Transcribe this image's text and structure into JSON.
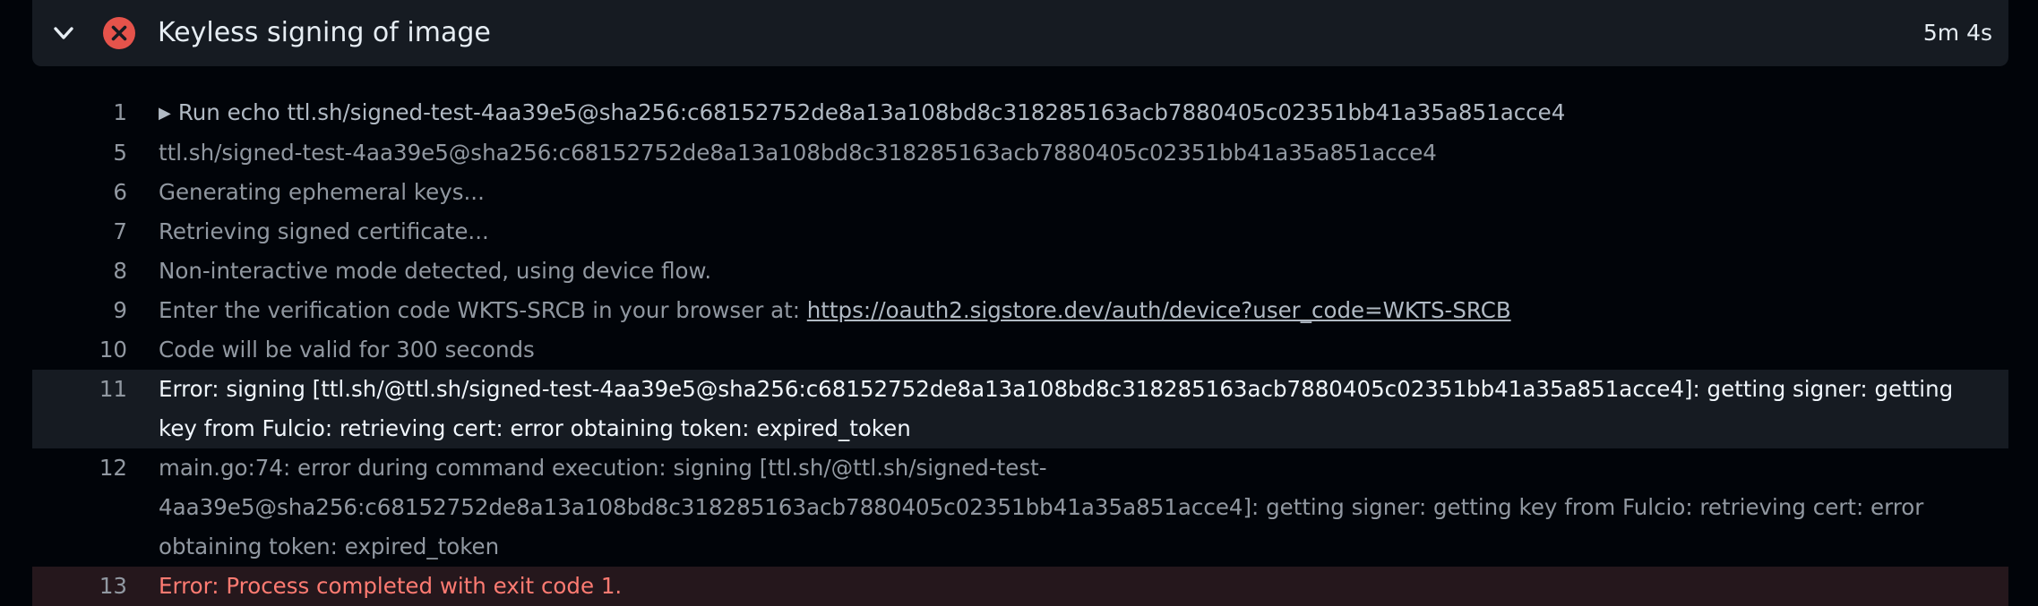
{
  "step": {
    "title": "Keyless signing of image",
    "duration": "5m 4s",
    "status": "failed",
    "status_color": "#e5534b",
    "icons": {
      "collapse": "chevron-down-icon",
      "status": "x-circle-icon",
      "expand_run": "triangle-right-icon"
    }
  },
  "log": [
    {
      "num": "1",
      "text": "Run echo ttl.sh/signed-test-4aa39e5@sha256:c68152752de8a13a108bd8c318285163acb7880405c02351bb41a35a851acce4"
    },
    {
      "num": "5",
      "text": "ttl.sh/signed-test-4aa39e5@sha256:c68152752de8a13a108bd8c318285163acb7880405c02351bb41a35a851acce4"
    },
    {
      "num": "6",
      "text": "Generating ephemeral keys..."
    },
    {
      "num": "7",
      "text": "Retrieving signed certificate..."
    },
    {
      "num": "8",
      "text": "Non-interactive mode detected, using device flow."
    },
    {
      "num": "9",
      "text": "Enter the verification code WKTS-SRCB in your browser at: ",
      "link": "https://oauth2.sigstore.dev/auth/device?user_code=WKTS-SRCB"
    },
    {
      "num": "10",
      "text": "Code will be valid for 300 seconds"
    },
    {
      "num": "11",
      "text": "Error: signing [ttl.sh/@ttl.sh/signed-test-4aa39e5@sha256:c68152752de8a13a108bd8c318285163acb7880405c02351bb41a35a851acce4]: getting signer: getting key from Fulcio: retrieving cert: error obtaining token: expired_token"
    },
    {
      "num": "12",
      "text": "main.go:74: error during command execution: signing [ttl.sh/@ttl.sh/signed-test-4aa39e5@sha256:c68152752de8a13a108bd8c318285163acb7880405c02351bb41a35a851acce4]: getting signer: getting key from Fulcio: retrieving cert: error obtaining token: expired_token"
    },
    {
      "num": "13",
      "text": "Error: Process completed with exit code 1."
    }
  ]
}
